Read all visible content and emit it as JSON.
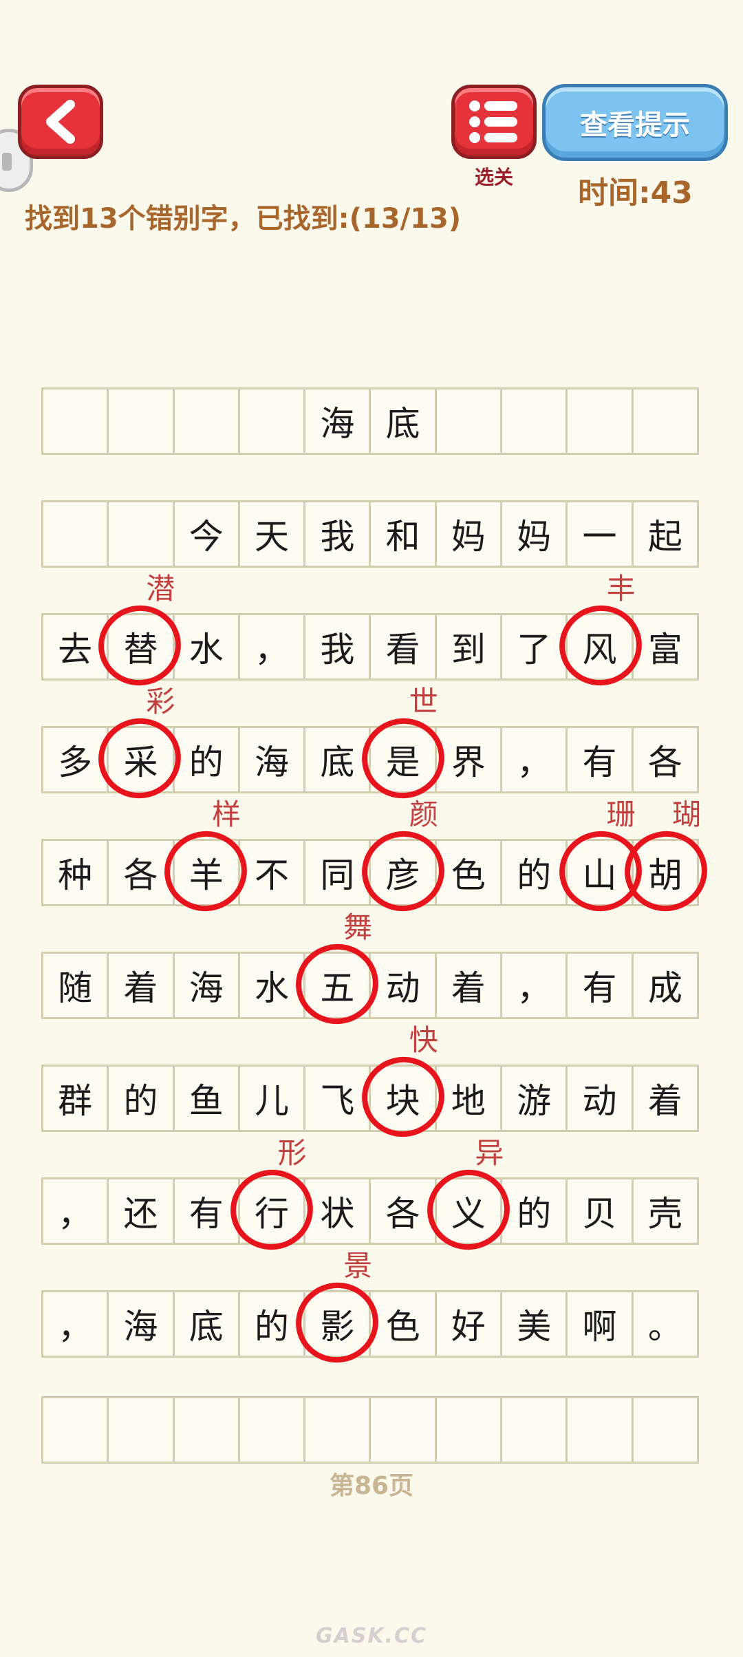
{
  "header": {
    "hint_label": "查看提示",
    "menu_label": "选关",
    "timer": "时间:43",
    "goal_text": "找到13个错别字，已找到:(13/13)"
  },
  "colors": {
    "button_red": "#e6323a",
    "button_blue": "#7cc4ef",
    "accent_brown": "#a8662b",
    "mark_red": "#e8141c",
    "background": "#fbf8ec"
  },
  "icons": {
    "back": "chevron-left-icon",
    "menu": "list-icon",
    "side": "pull-handle-icon"
  },
  "grid": {
    "rows": [
      [
        "",
        "",
        "",
        "",
        "海",
        "底",
        "",
        "",
        "",
        ""
      ],
      [
        "",
        "",
        "今",
        "天",
        "我",
        "和",
        "妈",
        "妈",
        "一",
        "起"
      ],
      [
        "去",
        "替",
        "水",
        "，",
        "我",
        "看",
        "到",
        "了",
        "风",
        "富"
      ],
      [
        "多",
        "采",
        "的",
        "海",
        "底",
        "是",
        "界",
        "，",
        "有",
        "各"
      ],
      [
        "种",
        "各",
        "羊",
        "不",
        "同",
        "彦",
        "色",
        "的",
        "山",
        "胡"
      ],
      [
        "随",
        "着",
        "海",
        "水",
        "五",
        "动",
        "着",
        "，",
        "有",
        "成"
      ],
      [
        "群",
        "的",
        "鱼",
        "儿",
        "飞",
        "块",
        "地",
        "游",
        "动",
        "着"
      ],
      [
        "，",
        "还",
        "有",
        "行",
        "状",
        "各",
        "义",
        "的",
        "贝",
        "壳"
      ],
      [
        "，",
        "海",
        "底",
        "的",
        "影",
        "色",
        "好",
        "美",
        "啊",
        "。"
      ],
      [
        "",
        "",
        "",
        "",
        "",
        "",
        "",
        "",
        "",
        ""
      ]
    ]
  },
  "marks": [
    {
      "row": 2,
      "col": 1,
      "correction": "潜"
    },
    {
      "row": 2,
      "col": 8,
      "correction": "丰"
    },
    {
      "row": 3,
      "col": 1,
      "correction": "彩"
    },
    {
      "row": 3,
      "col": 5,
      "correction": "世"
    },
    {
      "row": 4,
      "col": 2,
      "correction": "样"
    },
    {
      "row": 4,
      "col": 5,
      "correction": "颜"
    },
    {
      "row": 4,
      "col": 8,
      "correction": "珊"
    },
    {
      "row": 4,
      "col": 9,
      "correction": "瑚"
    },
    {
      "row": 5,
      "col": 4,
      "correction": "舞"
    },
    {
      "row": 6,
      "col": 5,
      "correction": "快"
    },
    {
      "row": 7,
      "col": 3,
      "correction": "形"
    },
    {
      "row": 7,
      "col": 6,
      "correction": "异"
    },
    {
      "row": 8,
      "col": 4,
      "correction": "景"
    }
  ],
  "footer": {
    "page": "第86页",
    "watermark": "GASK.CC"
  }
}
